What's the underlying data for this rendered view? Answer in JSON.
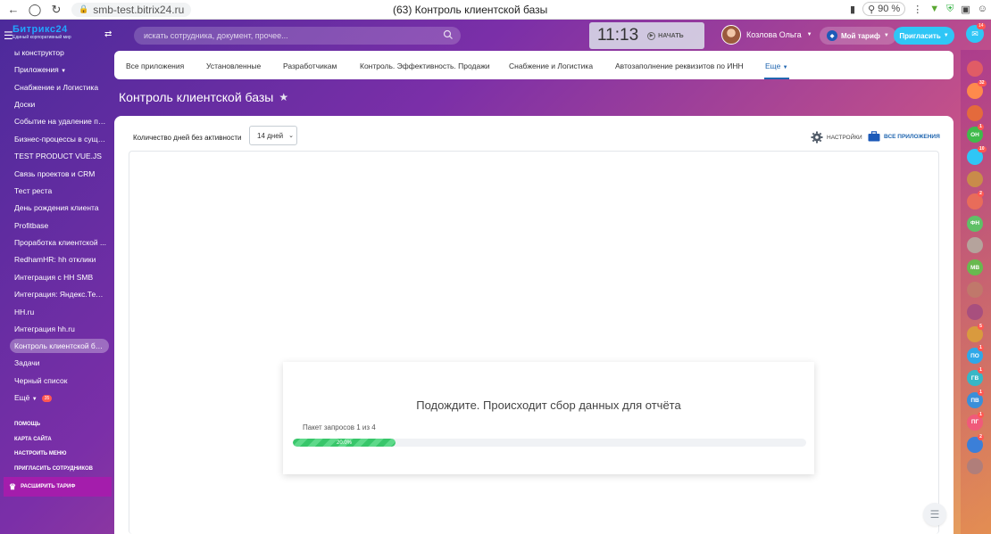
{
  "browser": {
    "url": "smb-test.bitrix24.ru",
    "tab_title": "(63) Контроль клиентской базы",
    "zoom": "90 %"
  },
  "header": {
    "logo_title": "Битрикс24",
    "logo_subtitle": "Единый корпоративный мир",
    "search_placeholder": "искать сотрудника, документ, прочее...",
    "time": "11:13",
    "start_label": "НАЧАТЬ",
    "user_name": "Козлова Ольга",
    "tariff_label": "Мой тариф",
    "invite_label": "Пригласить",
    "chat_count": "14"
  },
  "sidebar": {
    "items": [
      {
        "label": "ы конструктор"
      },
      {
        "label": "Приложения"
      },
      {
        "label": "Снабжение и Логистика"
      },
      {
        "label": "Доски"
      },
      {
        "label": "Событие на удаление по..."
      },
      {
        "label": "Бизнес-процессы в сущн..."
      },
      {
        "label": "TEST PRODUCT VUE.JS"
      },
      {
        "label": "Связь проектов и CRM"
      },
      {
        "label": "Тест реста"
      },
      {
        "label": "День рождения клиента"
      },
      {
        "label": "Profitbase"
      },
      {
        "label": "Проработка клиентской ..."
      },
      {
        "label": "RedhamHR: hh отклики"
      },
      {
        "label": "Интеграция с HH SMB"
      },
      {
        "label": "Интеграция: Яндекс.Теле..."
      },
      {
        "label": "HH.ru"
      },
      {
        "label": "Интеграция hh.ru"
      },
      {
        "label": "Контроль клиентской ба..."
      },
      {
        "label": "Задачи"
      },
      {
        "label": "Черный список"
      },
      {
        "label": "Ещё"
      }
    ],
    "more_count": "35",
    "help": "ПОМОЩЬ",
    "sitemap": "КАРТА САЙТА",
    "configure": "НАСТРОИТЬ МЕНЮ",
    "invite": "ПРИГЛАСИТЬ СОТРУДНИКОВ",
    "expand_tariff": "РАСШИРИТЬ ТАРИФ"
  },
  "tabs": [
    {
      "label": "Все приложения"
    },
    {
      "label": "Установленные"
    },
    {
      "label": "Разработчикам"
    },
    {
      "label": "Контроль. Эффективность. Продажи"
    },
    {
      "label": "Снабжение и Логистика"
    },
    {
      "label": "Автозаполнение реквизитов по ИНН"
    },
    {
      "label": "Еще"
    }
  ],
  "page": {
    "title": "Контроль клиентской базы"
  },
  "filter": {
    "days_label": "Количество дней без активности",
    "days_value": "14 дней"
  },
  "actions": {
    "settings": "НАСТРОЙКИ",
    "all_apps": "ВСЕ ПРИЛОЖЕНИЯ"
  },
  "loading": {
    "title": "Подождите. Происходит сбор данных для отчёта",
    "subtitle": "Пакет запросов 1 из 4",
    "progress_label": "20.0%",
    "progress_fraction": 0.2
  },
  "rightbar": [
    {
      "label": "",
      "color": "#e05c66"
    },
    {
      "label": "",
      "color": "#ff8a4c",
      "badge": "32"
    },
    {
      "label": "",
      "color": "#e46a3c"
    },
    {
      "label": "ОН",
      "color": "#3fbb4b",
      "badge": "1"
    },
    {
      "label": "",
      "color": "#2fc6f6",
      "badge": "10"
    },
    {
      "label": "",
      "color": "#c98b4a"
    },
    {
      "label": "",
      "color": "#e86c5a",
      "badge": "2"
    },
    {
      "label": "ФН",
      "color": "#5fc067"
    },
    {
      "label": "",
      "color": "#b5a39c"
    },
    {
      "label": "МВ",
      "color": "#68b94f"
    },
    {
      "label": "",
      "color": "#c0786b"
    },
    {
      "label": "",
      "color": "#a84f7e"
    },
    {
      "label": "",
      "color": "#d99a3e",
      "badge": "5"
    },
    {
      "label": "ПО",
      "color": "#2fa8e8",
      "badge": "1"
    },
    {
      "label": "ГВ",
      "color": "#37b7c6",
      "badge": "1"
    },
    {
      "label": "ПВ",
      "color": "#3a8fd9",
      "badge": "1"
    },
    {
      "label": "ПГ",
      "color": "#f05a7a",
      "badge": "1"
    },
    {
      "label": "",
      "color": "#3b7fd8",
      "badge": "2"
    },
    {
      "label": "",
      "color": "#b07e7a"
    }
  ]
}
